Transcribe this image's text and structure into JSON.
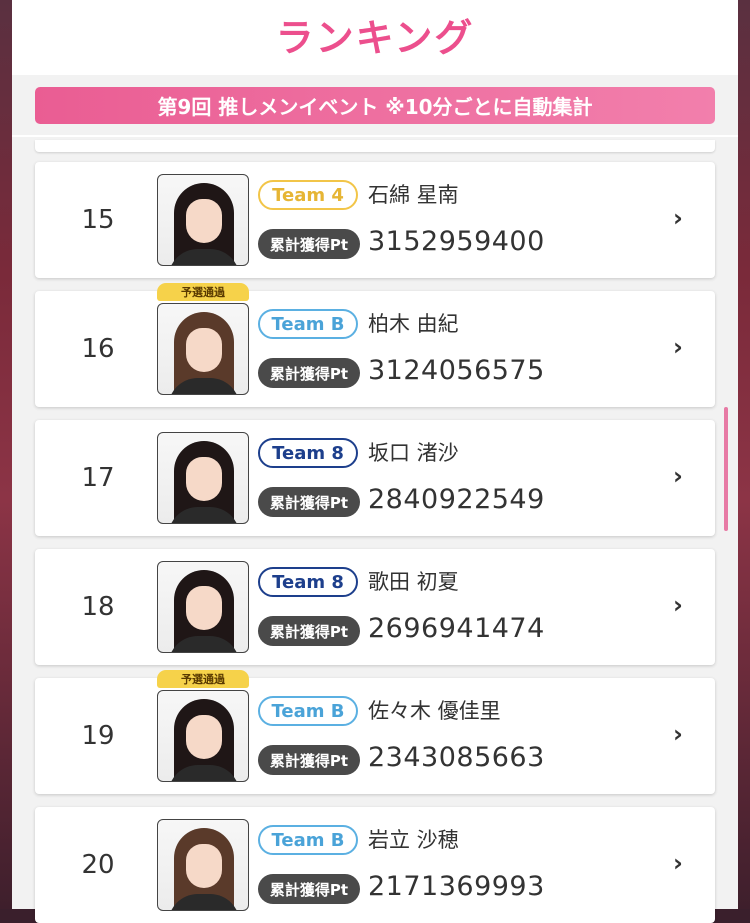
{
  "header": {
    "title": "ランキング"
  },
  "banner": {
    "text": "第9回 推しメンイベント ※10分ごとに自動集計"
  },
  "pt_label": "累計獲得Pt",
  "pass_badge": "予選通過",
  "rows": [
    {
      "rank": "15",
      "team": "Team 4",
      "name": "石綿 星南",
      "points": "3152959400",
      "passed": false
    },
    {
      "rank": "16",
      "team": "Team B",
      "name": "柏木 由紀",
      "points": "3124056575",
      "passed": true
    },
    {
      "rank": "17",
      "team": "Team 8",
      "name": "坂口 渚沙",
      "points": "2840922549",
      "passed": false
    },
    {
      "rank": "18",
      "team": "Team 8",
      "name": "歌田 初夏",
      "points": "2696941474",
      "passed": false
    },
    {
      "rank": "19",
      "team": "Team B",
      "name": "佐々木 優佳里",
      "points": "2343085663",
      "passed": true
    },
    {
      "rank": "20",
      "team": "Team B",
      "name": "岩立 沙穂",
      "points": "2171369993",
      "passed": false
    }
  ],
  "icons": {
    "chevron": "chevron-right-icon",
    "photo": "member-photo"
  },
  "colors": {
    "accent": "#ec4f8d",
    "team4": "#f2c548",
    "teamB": "#5bb0e2",
    "team8": "#1d3f8c",
    "pass_badge": "#f6d24a"
  }
}
